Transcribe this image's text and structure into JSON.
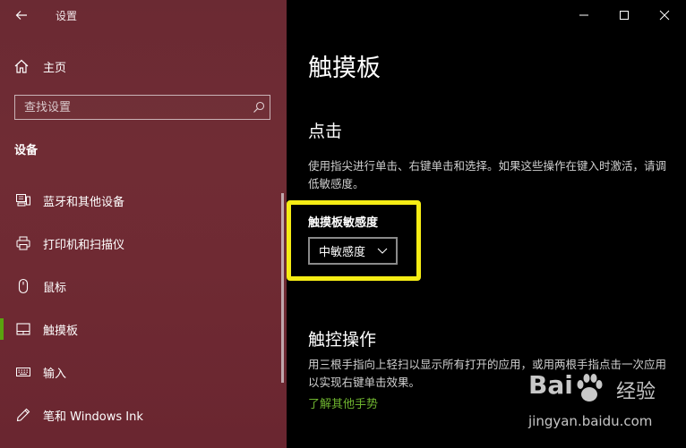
{
  "window": {
    "app_title": "设置"
  },
  "sidebar": {
    "home_label": "主页",
    "search": {
      "placeholder": "查找设置",
      "value": ""
    },
    "section_header": "设备",
    "items": [
      {
        "label": "蓝牙和其他设备",
        "icon": "bluetooth-devices-icon"
      },
      {
        "label": "打印机和扫描仪",
        "icon": "printer-icon"
      },
      {
        "label": "鼠标",
        "icon": "mouse-icon"
      },
      {
        "label": "触摸板",
        "icon": "touchpad-icon",
        "active": true
      },
      {
        "label": "输入",
        "icon": "keyboard-icon"
      },
      {
        "label": "笔和 Windows Ink",
        "icon": "pen-icon"
      }
    ]
  },
  "main": {
    "page_title": "触摸板",
    "click_section": {
      "heading": "点击",
      "description": "使用指尖进行单击、右键单击和选择。如果这些操作在键入时激活，请调低敏感度。",
      "sensitivity_label": "触摸板敏感度",
      "sensitivity_value": "中敏感度"
    },
    "gesture_section": {
      "heading": "触控操作",
      "description": "用三根手指向上轻扫以显示所有打开的应用，或用两根手指点击一次应用以实现右键单击效果。",
      "link": "了解其他手势"
    }
  },
  "watermark": {
    "logo": "Bai",
    "logo_tail": "经验",
    "url": "jingyan.baidu.com"
  },
  "colors": {
    "sidebar_bg": "#6f2a33",
    "accent_green": "#5aa30f",
    "link_green": "#6fb42f",
    "highlight_yellow": "#f5ec14"
  }
}
